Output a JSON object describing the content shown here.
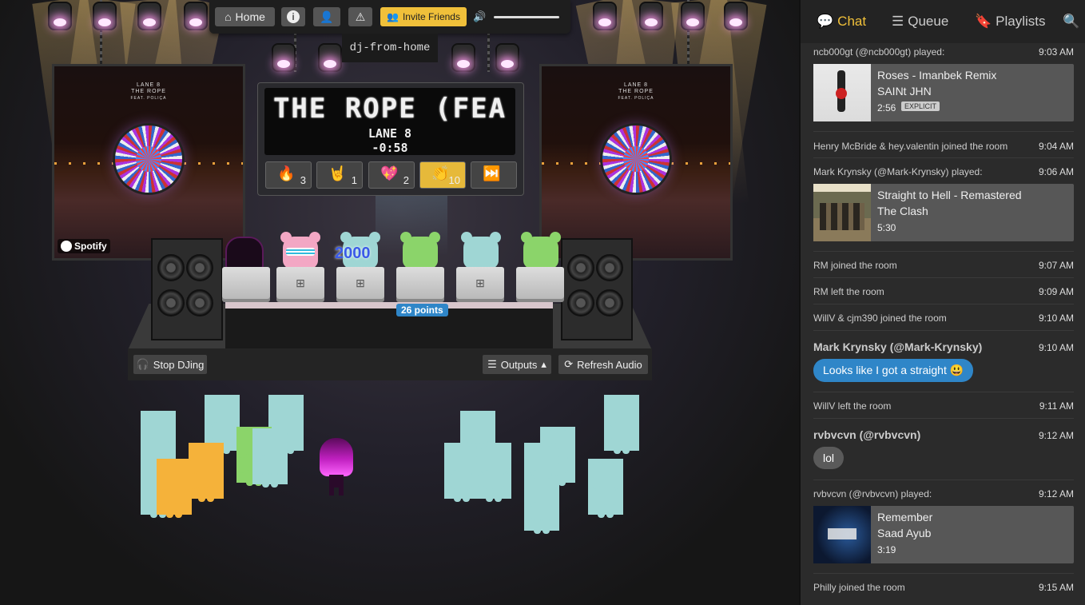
{
  "toolbar": {
    "home_label": "Home",
    "info_icon": "info-icon",
    "user_settings_icon": "user-cog-icon",
    "warning_icon": "warning-icon",
    "invite_label": "Invite Friends",
    "volume_icon": "volume-icon",
    "volume_level": 1.0
  },
  "room": {
    "name": "dj-from-home"
  },
  "now_playing": {
    "marquee_title": "THE ROPE (FEA",
    "artist": "LANE 8",
    "time_remaining": "-0:58",
    "album_art_title": "LANE 8\nTHE ROPE",
    "album_art_subtitle": "FEAT. POLIÇA",
    "provider": "Spotify"
  },
  "reactions": [
    {
      "name": "fire-reaction",
      "emoji": "🔥",
      "count": "3"
    },
    {
      "name": "rock-on-reaction",
      "emoji": "🤘",
      "count": "1"
    },
    {
      "name": "heart-reaction",
      "emoji": "💖",
      "count": "2"
    },
    {
      "name": "clap-reaction",
      "emoji": "👏",
      "count": "10"
    },
    {
      "name": "skip-reaction",
      "emoji": "⏭️",
      "count": ""
    }
  ],
  "booth": {
    "points_label": "26 points",
    "dj_badge": "2000",
    "stop_djing_label": "Stop DJing",
    "outputs_label": "Outputs",
    "refresh_audio_label": "Refresh Audio"
  },
  "sidebar": {
    "tabs": [
      {
        "label": "Chat",
        "icon": "chat-icon",
        "active": true
      },
      {
        "label": "Queue",
        "icon": "list-icon",
        "active": false
      },
      {
        "label": "Playlists",
        "icon": "bookmark-icon",
        "active": false
      }
    ],
    "search_icon": "search-icon",
    "feed": {
      "played1_header": "ncb000gt (@ncb000gt) played:",
      "played1_time": "9:03 AM",
      "track1_title": "Roses - Imanbek Remix",
      "track1_artist": "SAINt JHN",
      "track1_duration": "2:56",
      "track1_badge": "EXPLICIT",
      "ev1_text": "Henry McBride & hey.valentin joined the room",
      "ev1_time": "9:04 AM",
      "played2_header": "Mark Krynsky (@Mark-Krynsky) played:",
      "played2_time": "9:06 AM",
      "track2_title": "Straight to Hell - Remastered",
      "track2_artist": "The Clash",
      "track2_duration": "5:30",
      "ev2_text": "RM joined the room",
      "ev2_time": "9:07 AM",
      "ev3_text": "RM left the room",
      "ev3_time": "9:09 AM",
      "ev4_text": "WillV & cjm390 joined the room",
      "ev4_time": "9:10 AM",
      "msg1_user": "Mark Krynsky (@Mark-Krynsky)",
      "msg1_time": "9:10 AM",
      "msg1_text": "Looks like I got a straight 😃",
      "ev5_text": "WillV left the room",
      "ev5_time": "9:11 AM",
      "msg2_user": "rvbvcvn (@rvbvcvn)",
      "msg2_time": "9:12 AM",
      "msg2_text": "lol",
      "played3_header": "rvbvcvn (@rvbvcvn) played:",
      "played3_time": "9:12 AM",
      "track3_title": "Remember",
      "track3_artist": "Saad Ayub",
      "track3_duration": "3:19",
      "ev6_text": "Philly joined the room",
      "ev6_time": "9:15 AM"
    }
  },
  "colors": {
    "accent_yellow": "#f0c03a",
    "bubble_blue": "#2f86c8",
    "bubble_gray": "#5a5a5a",
    "bear_teal": "#9fd6d4",
    "bear_orange": "#f5b23a",
    "bear_green": "#8bd46a",
    "avatar_purple": "#c020c0"
  }
}
